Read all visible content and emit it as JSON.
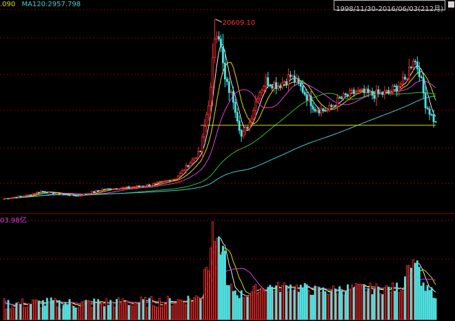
{
  "header": {
    "ma_partial": ".090",
    "ma120_label": "MA120:2957.798",
    "date_range": "1998/11/30-2016/06/03(212月)"
  },
  "volume_panel": {
    "label": "03.98亿"
  },
  "colors": {
    "up": "#ff3030",
    "down": "#50e0e0",
    "ma5": "#e8e8e8",
    "ma10": "#e0e000",
    "ma20": "#e040e0",
    "ma60": "#30c030",
    "ma120": "#40d0d0",
    "grid": "#8b0000",
    "support": "#e0e000"
  },
  "chart_data": {
    "type": "candlestick",
    "period": "monthly",
    "date_range": "1998/11/30-2016/06/03",
    "count": 212,
    "price_scale": {
      "min": 0,
      "max": 21500
    },
    "annotations": [
      {
        "text": "20609.10",
        "type": "high"
      }
    ],
    "support_level": 9200,
    "volume_scale_max": 100,
    "ma120_last": 2957.798
  }
}
